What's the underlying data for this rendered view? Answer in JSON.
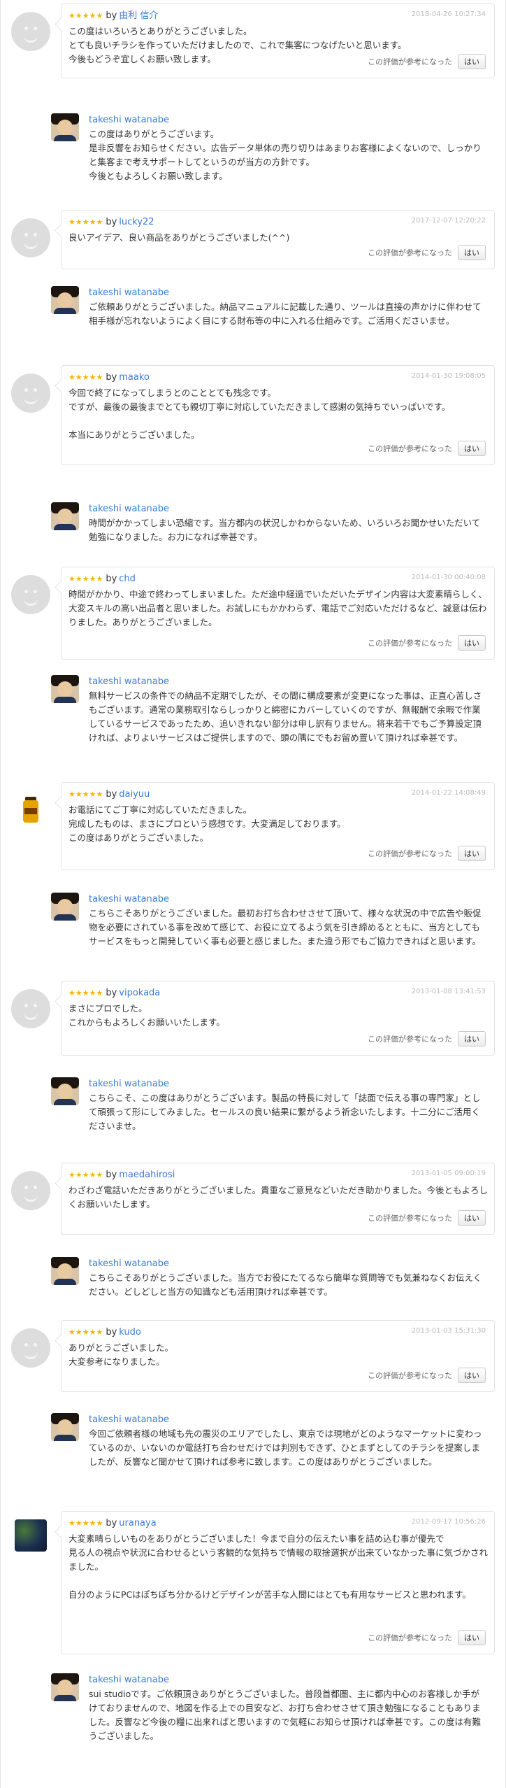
{
  "colors": {
    "star": "#f7b500",
    "user_link": "#3a7bd5",
    "date": "#bbbbbb",
    "border": "#e3e3e3"
  },
  "ui": {
    "by": "by",
    "stars": "★★★★★",
    "helpful_label": "この評価が参考になった",
    "yes_button": "はい"
  },
  "reviews": [
    {
      "avatar": "default-avatar",
      "user": "由利 信介",
      "date": "2018-04-26 10:27:34",
      "text": "この度はいろいろとありがとうございました。\nとても良いチラシを作っていただけましたので、これで集客につなげたいと思います。\n今後もどうぞ宜しくお願い致します。",
      "reply_author": "takeshi watanabe",
      "reply_text": "この度はありがとうございます。\n是非反響をお知らせください。広告データ単体の売り切りはあまりお客様によくないので、しっかりと集客まで考えサポートしてというのが当方の方針です。\n今後ともよろしくお願い致します。"
    },
    {
      "avatar": "default-avatar",
      "user": "lucky22",
      "date": "2017-12-07 12:20:22",
      "text": "良いアイデア、良い商品をありがとうございました(^^)",
      "reply_author": "takeshi watanabe",
      "reply_text": "ご依頼ありがとうございました。納品マニュアルに記載した通り、ツールは直接の声かけに伴わせて相手様が忘れないようによく目にする財布等の中に入れる仕組みです。ご活用くださいませ。"
    },
    {
      "avatar": "default-avatar",
      "user": "maako",
      "date": "2014-01-30 19:08:05",
      "text": "今回で終了になってしまうとのこととても残念です。\nですが、最後の最後までとても親切丁寧に対応していただきまして感謝の気持ちでいっぱいです。\n\n本当にありがとうございました。",
      "reply_author": "takeshi watanabe",
      "reply_text": "時間がかかってしまい恐縮です。当方都内の状況しかわからないため、いろいろお聞かせいただいて勉強になりました。お力になれば幸甚です。"
    },
    {
      "avatar": "default-avatar",
      "user": "chd",
      "date": "2014-01-30 00:40:08",
      "text": "時間がかかり、中途で終わってしまいました。ただ途中経過でいただいたデザイン内容は大変素晴らしく、大変スキルの高い出品者と思いました。お試しにもかかわらず、電話でご対応いただけるなど、誠意は伝わりました。ありがとうございました。",
      "reply_author": "takeshi watanabe",
      "reply_text": "無料サービスの条件での納品不定期でしたが、その間に構成要素が変更になった事は、正直心苦しさもございます。通常の業務取引ならしっかりと綿密にカバーしていくのですが、無報酬で余暇で作業しているサービスであったため、追いきれない部分は申し訳有りません。将来若干でもご予算設定頂ければ、よりよいサービスはご提供しますので、頭の隅にでもお留め置いて頂ければ幸甚です。"
    },
    {
      "avatar": "honey-jar-avatar",
      "user": "daiyuu",
      "date": "2014-01-22 14:08:49",
      "text": "お電話にてご丁寧に対応していただきました。\n完成したものは、まさにプロという感想です。大変満足しております。\nこの度はありがとうございました。",
      "reply_author": "takeshi watanabe",
      "reply_text": "こちらこそありがとうございました。最初お打ち合わせさせて頂いて、様々な状況の中で広告や販促物を必要にされている事を改めて感じて、お役に立てるよう気を引き締めるとともに、当方としてもサービスをもっと開発していく事も必要と感じました。また違う形でもご協力できればと思います。"
    },
    {
      "avatar": "default-avatar",
      "user": "vipokada",
      "date": "2013-01-08 13:41:53",
      "text": "まさにプロでした。\nこれからもよろしくお願いいたします。",
      "reply_author": "takeshi watanabe",
      "reply_text": "こちらこそ、この度はありがとうございます。製品の特長に対して「誌面で伝える事の専門家」として頑張って形にしてみました。セールスの良い結果に繋がるよう祈念いたします。十二分にご活用くださいませ。"
    },
    {
      "avatar": "default-avatar",
      "user": "maedahirosi",
      "date": "2013-01-05 09:00:19",
      "text": "わざわざ電話いただきありがとうございました。貴重なご意見などいただき助かりました。今後ともよろしくお願いいたします。",
      "reply_author": "takeshi watanabe",
      "reply_text": "こちらこそありがとうございました。当方でお役にたてるなら簡単な質問等でも気兼ねなくお伝えください。どしどしと当方の知識なども活用頂ければ幸甚です。"
    },
    {
      "avatar": "default-avatar",
      "user": "kudo",
      "date": "2013-01-03 15:31:30",
      "text": "ありがとうございました。\n大変参考になりました。",
      "reply_author": "takeshi watanabe",
      "reply_text": "今回ご依頼者様の地域も先の震災のエリアでしたし、東京では現地がどのようなマーケットに変わっているのか、いないのか電話打ち合わせだけでは判別もできず、ひとまずとしてのチラシを提案しましたが、反響など聞かせて頂ければ参考に致します。この度はありがとうございました。"
    },
    {
      "avatar": "photo-avatar",
      "user": "uranaya",
      "date": "2012-09-17 10:56:26",
      "text": "大変素晴らしいものをありがとうございました！今まで自分の伝えたい事を詰め込む事が優先で\n見る人の視点や状況に合わせるという客観的な気持ちで情報の取捨選択が出来ていなかった事に気づかされました。\n\n自分のようにPCはぽちぽち分かるけどデザインが苦手な人間にはとても有用なサービスと思われます。",
      "reply_author": "takeshi watanabe",
      "reply_text": "sui studioです。ご依頼頂きありがとうございました。普段首都圏、主に都内中心のお客様しか手がけておりませんので、地図を作る上での目安など、お打ち合わせさせて頂き勉強になることもありました。反響など今後の糧に出来ればと思いますので気軽にお知らせ頂ければ幸甚です。この度は有難うございました。"
    }
  ]
}
